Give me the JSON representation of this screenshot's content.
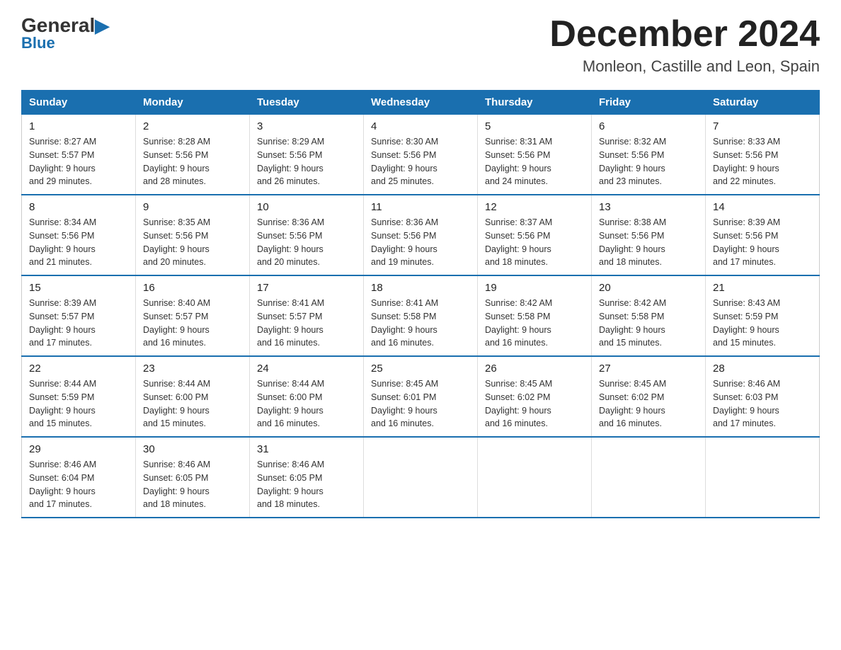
{
  "logo": {
    "general": "General",
    "arrow": "▶",
    "blue": "Blue"
  },
  "header": {
    "month": "December 2024",
    "location": "Monleon, Castille and Leon, Spain"
  },
  "weekdays": [
    "Sunday",
    "Monday",
    "Tuesday",
    "Wednesday",
    "Thursday",
    "Friday",
    "Saturday"
  ],
  "weeks": [
    [
      {
        "day": "1",
        "sunrise": "8:27 AM",
        "sunset": "5:57 PM",
        "daylight": "9 hours and 29 minutes."
      },
      {
        "day": "2",
        "sunrise": "8:28 AM",
        "sunset": "5:56 PM",
        "daylight": "9 hours and 28 minutes."
      },
      {
        "day": "3",
        "sunrise": "8:29 AM",
        "sunset": "5:56 PM",
        "daylight": "9 hours and 26 minutes."
      },
      {
        "day": "4",
        "sunrise": "8:30 AM",
        "sunset": "5:56 PM",
        "daylight": "9 hours and 25 minutes."
      },
      {
        "day": "5",
        "sunrise": "8:31 AM",
        "sunset": "5:56 PM",
        "daylight": "9 hours and 24 minutes."
      },
      {
        "day": "6",
        "sunrise": "8:32 AM",
        "sunset": "5:56 PM",
        "daylight": "9 hours and 23 minutes."
      },
      {
        "day": "7",
        "sunrise": "8:33 AM",
        "sunset": "5:56 PM",
        "daylight": "9 hours and 22 minutes."
      }
    ],
    [
      {
        "day": "8",
        "sunrise": "8:34 AM",
        "sunset": "5:56 PM",
        "daylight": "9 hours and 21 minutes."
      },
      {
        "day": "9",
        "sunrise": "8:35 AM",
        "sunset": "5:56 PM",
        "daylight": "9 hours and 20 minutes."
      },
      {
        "day": "10",
        "sunrise": "8:36 AM",
        "sunset": "5:56 PM",
        "daylight": "9 hours and 20 minutes."
      },
      {
        "day": "11",
        "sunrise": "8:36 AM",
        "sunset": "5:56 PM",
        "daylight": "9 hours and 19 minutes."
      },
      {
        "day": "12",
        "sunrise": "8:37 AM",
        "sunset": "5:56 PM",
        "daylight": "9 hours and 18 minutes."
      },
      {
        "day": "13",
        "sunrise": "8:38 AM",
        "sunset": "5:56 PM",
        "daylight": "9 hours and 18 minutes."
      },
      {
        "day": "14",
        "sunrise": "8:39 AM",
        "sunset": "5:56 PM",
        "daylight": "9 hours and 17 minutes."
      }
    ],
    [
      {
        "day": "15",
        "sunrise": "8:39 AM",
        "sunset": "5:57 PM",
        "daylight": "9 hours and 17 minutes."
      },
      {
        "day": "16",
        "sunrise": "8:40 AM",
        "sunset": "5:57 PM",
        "daylight": "9 hours and 16 minutes."
      },
      {
        "day": "17",
        "sunrise": "8:41 AM",
        "sunset": "5:57 PM",
        "daylight": "9 hours and 16 minutes."
      },
      {
        "day": "18",
        "sunrise": "8:41 AM",
        "sunset": "5:58 PM",
        "daylight": "9 hours and 16 minutes."
      },
      {
        "day": "19",
        "sunrise": "8:42 AM",
        "sunset": "5:58 PM",
        "daylight": "9 hours and 16 minutes."
      },
      {
        "day": "20",
        "sunrise": "8:42 AM",
        "sunset": "5:58 PM",
        "daylight": "9 hours and 15 minutes."
      },
      {
        "day": "21",
        "sunrise": "8:43 AM",
        "sunset": "5:59 PM",
        "daylight": "9 hours and 15 minutes."
      }
    ],
    [
      {
        "day": "22",
        "sunrise": "8:44 AM",
        "sunset": "5:59 PM",
        "daylight": "9 hours and 15 minutes."
      },
      {
        "day": "23",
        "sunrise": "8:44 AM",
        "sunset": "6:00 PM",
        "daylight": "9 hours and 15 minutes."
      },
      {
        "day": "24",
        "sunrise": "8:44 AM",
        "sunset": "6:00 PM",
        "daylight": "9 hours and 16 minutes."
      },
      {
        "day": "25",
        "sunrise": "8:45 AM",
        "sunset": "6:01 PM",
        "daylight": "9 hours and 16 minutes."
      },
      {
        "day": "26",
        "sunrise": "8:45 AM",
        "sunset": "6:02 PM",
        "daylight": "9 hours and 16 minutes."
      },
      {
        "day": "27",
        "sunrise": "8:45 AM",
        "sunset": "6:02 PM",
        "daylight": "9 hours and 16 minutes."
      },
      {
        "day": "28",
        "sunrise": "8:46 AM",
        "sunset": "6:03 PM",
        "daylight": "9 hours and 17 minutes."
      }
    ],
    [
      {
        "day": "29",
        "sunrise": "8:46 AM",
        "sunset": "6:04 PM",
        "daylight": "9 hours and 17 minutes."
      },
      {
        "day": "30",
        "sunrise": "8:46 AM",
        "sunset": "6:05 PM",
        "daylight": "9 hours and 18 minutes."
      },
      {
        "day": "31",
        "sunrise": "8:46 AM",
        "sunset": "6:05 PM",
        "daylight": "9 hours and 18 minutes."
      },
      null,
      null,
      null,
      null
    ]
  ]
}
